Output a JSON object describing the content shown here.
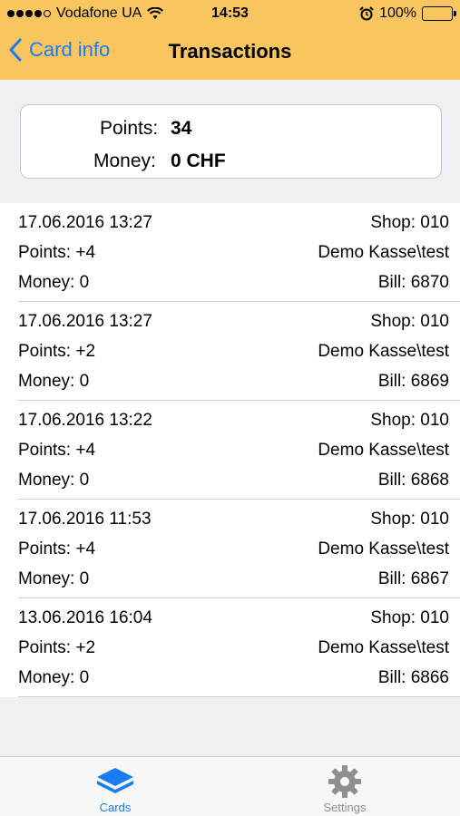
{
  "status_bar": {
    "carrier": "Vodafone UA",
    "time": "14:53",
    "battery": "100%"
  },
  "nav": {
    "back_label": "Card info",
    "title": "Transactions"
  },
  "summary": {
    "points_label": "Points:",
    "points_value": "34",
    "money_label": "Money:",
    "money_value": "0 CHF"
  },
  "transactions": [
    {
      "date": "17.06.2016 13:27",
      "points": "Points: +4",
      "money": "Money: 0",
      "shop": "Shop: 010",
      "kasse": "Demo Kasse\\test",
      "bill": "Bill: 6870"
    },
    {
      "date": "17.06.2016 13:27",
      "points": "Points: +2",
      "money": "Money: 0",
      "shop": "Shop: 010",
      "kasse": "Demo Kasse\\test",
      "bill": "Bill: 6869"
    },
    {
      "date": "17.06.2016 13:22",
      "points": "Points: +4",
      "money": "Money: 0",
      "shop": "Shop: 010",
      "kasse": "Demo Kasse\\test",
      "bill": "Bill: 6868"
    },
    {
      "date": "17.06.2016 11:53",
      "points": "Points: +4",
      "money": "Money: 0",
      "shop": "Shop: 010",
      "kasse": "Demo Kasse\\test",
      "bill": "Bill: 6867"
    },
    {
      "date": "13.06.2016 16:04",
      "points": "Points: +2",
      "money": "Money: 0",
      "shop": "Shop: 010",
      "kasse": "Demo Kasse\\test",
      "bill": "Bill: 6866"
    }
  ],
  "tabs": [
    {
      "label": "Cards",
      "icon": "cards-icon",
      "active": true
    },
    {
      "label": "Settings",
      "icon": "gear-icon",
      "active": false
    }
  ],
  "colors": {
    "nav_background": "#f8c55e",
    "accent": "#1a7cf5",
    "battery": "#4cd964"
  }
}
